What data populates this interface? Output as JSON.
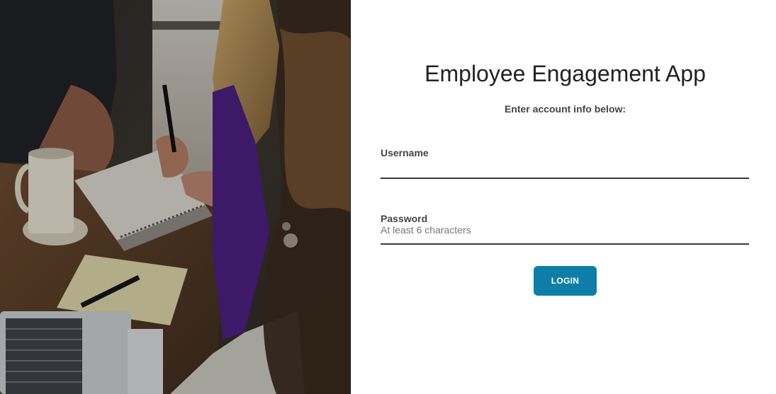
{
  "app": {
    "title": "Employee Engagement App",
    "subtitle": "Enter account info below:"
  },
  "form": {
    "username": {
      "label": "Username",
      "value": "",
      "placeholder": ""
    },
    "password": {
      "label": "Password",
      "value": "",
      "placeholder": "At least 6 characters"
    },
    "login_label": "LOGIN"
  },
  "colors": {
    "accent": "#0e7ea8",
    "text": "#222222",
    "label": "#444444",
    "underline": "#3a3a3a"
  },
  "icons": {
    "hero": "hero-photo-coworkers-with-notebooks"
  }
}
